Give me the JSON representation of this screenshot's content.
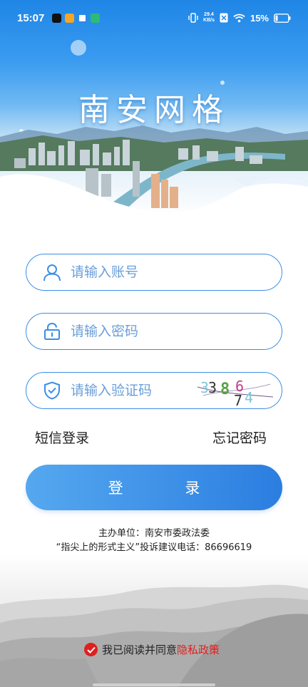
{
  "status_bar": {
    "time": "15:07",
    "net_speed_value": "29.4",
    "net_speed_unit": "KB/s",
    "battery": "15%",
    "icons": [
      "tiktok-icon",
      "weibo-icon",
      "app-icon",
      "app-icon",
      "vibrate-icon",
      "sim-icon",
      "wifi-icon",
      "battery-icon"
    ]
  },
  "app": {
    "title": "南安网格"
  },
  "form": {
    "account_placeholder": "请输入账号",
    "password_placeholder": "请输入密码",
    "captcha_placeholder": "请输入验证码",
    "captcha_code": [
      "3",
      "3",
      "8",
      "6",
      "7",
      "4"
    ]
  },
  "links": {
    "sms_login": "短信登录",
    "forgot_password": "忘记密码"
  },
  "login_button": "登  录",
  "info": {
    "sponsor": "主办单位：南安市委政法委",
    "complaint": "“指尖上的形式主义”投诉建议电话：86696619"
  },
  "consent": {
    "text": "我已阅读并同意",
    "policy_link": "隐私政策"
  },
  "colors": {
    "primary": "#2b7ee0",
    "field_border": "#3b8ee6",
    "placeholder": "#6a9fd8",
    "policy": "#e0201d"
  }
}
